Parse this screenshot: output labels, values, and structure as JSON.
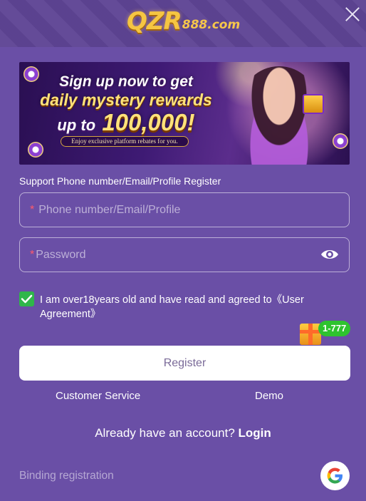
{
  "header": {
    "logo_main": "QZR",
    "logo_badge": "888",
    "logo_domain": "888.com",
    "close_icon": "close-icon"
  },
  "banner": {
    "line1": "Sign up now to get",
    "line2": "daily mystery rewards",
    "line3_prefix": "up to",
    "line3_amount": "100,000!",
    "subtitle": "Enjoy exclusive platform rebates for you."
  },
  "form": {
    "support_text": "Support Phone number/Email/Profile Register",
    "phone_required_mark": "*",
    "phone_placeholder": "Phone number/Email/Profile",
    "password_required_mark": "*",
    "password_placeholder": "Password",
    "password_toggle_icon": "eye-icon",
    "agree_checked": true,
    "agree_text": "I am over18years old and have read and agreed to《User Agreement》",
    "register_label": "Register"
  },
  "promo": {
    "gift_icon": "gift-icon",
    "badge_label": "1-777"
  },
  "links": {
    "customer_service": "Customer Service",
    "demo": "Demo",
    "already_account": "Already have an account?",
    "login": "Login",
    "binding_registration": "Binding registration",
    "google_icon": "google-icon"
  },
  "colors": {
    "background": "#6a4fa6",
    "header_background": "#5e4494",
    "check_green": "#2fb64a",
    "badge_green": "#2ec32e",
    "required_red": "#ff5a6a",
    "button_white": "#ffffff"
  }
}
